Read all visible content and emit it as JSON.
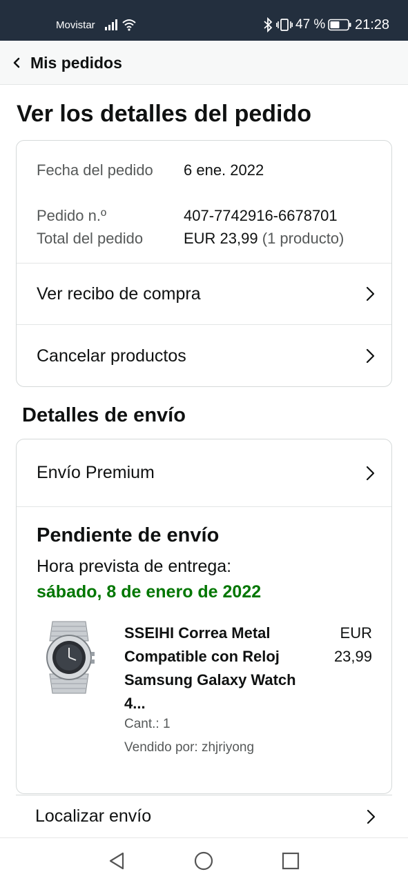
{
  "status_bar": {
    "carrier": "Movistar",
    "battery_percent": "47 %",
    "time": "21:28",
    "icons": [
      "signal-icon",
      "wifi-icon",
      "bluetooth-icon",
      "vibrate-icon",
      "battery-icon"
    ]
  },
  "header": {
    "back_label": "Mis pedidos"
  },
  "page_title": "Ver los detalles del pedido",
  "order": {
    "date_label": "Fecha del pedido",
    "date_value": "6 ene. 2022",
    "number_label": "Pedido n.º",
    "number_value": "407-7742916-6678701",
    "total_label": "Total del pedido",
    "total_value": "EUR 23,99",
    "total_count": "(1 producto)",
    "links": {
      "receipt": "Ver recibo de compra",
      "cancel": "Cancelar productos"
    }
  },
  "shipping": {
    "section_title": "Detalles de envío",
    "method": "Envío Premium",
    "status": "Pendiente de envío",
    "delivery_label": "Hora prevista de entrega:",
    "delivery_date": "sábado, 8 de enero de 2022",
    "delivery_color": "#007600",
    "product": {
      "title": "SSEIHI Correa Metal Compatible con Reloj Samsung Galaxy Watch 4...",
      "price_currency": "EUR",
      "price_amount": "23,99",
      "quantity": "Cant.: 1",
      "seller": "Vendido por: zhjriyong"
    },
    "track_label": "Localizar envío"
  },
  "colors": {
    "status_bar_bg": "#232f3e",
    "header_bg": "#f7f8f8",
    "text": "#0f1111",
    "muted": "#565959"
  }
}
